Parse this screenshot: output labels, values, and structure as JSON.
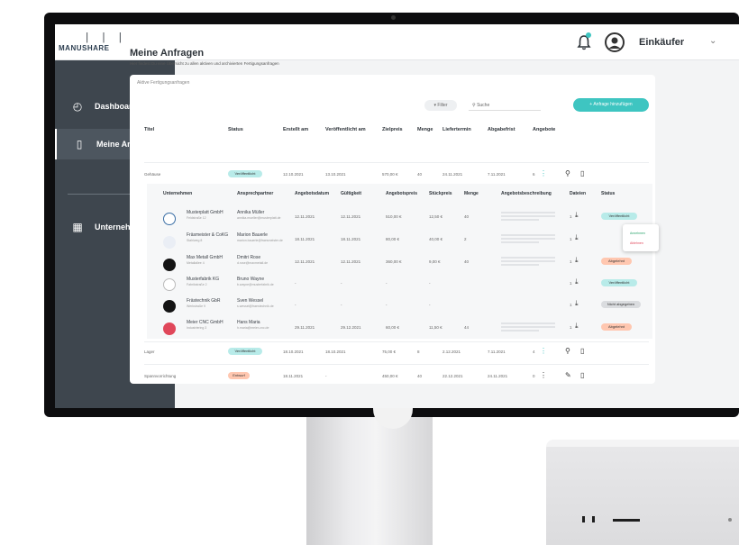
{
  "app": {
    "logo_text": "MANUSHARE",
    "logo_bars": "| | |",
    "user": "Einkäufer"
  },
  "sidebar": {
    "items": [
      {
        "label": "Dashboard"
      },
      {
        "label": "Meine Anfragen"
      },
      {
        "label": "Unternehmen"
      }
    ]
  },
  "main": {
    "title": "Meine Anfragen",
    "subtitle": "Hier findest Du eine Übersicht zu allen aktiven und archivierten Fertigungsanfragen",
    "card_title": "Aktive Fertigungsanfragen",
    "filter_label": "Filter",
    "search_placeholder": "Suche",
    "add_label": "+ Anfrage hinzufügen"
  },
  "table": {
    "headers": [
      "Titel",
      "Status",
      "Erstellt am",
      "Veröffentlicht am",
      "Zielpreis",
      "Menge",
      "Liefertermin",
      "Abgabefrist",
      "Angebote"
    ],
    "rows": [
      {
        "title": "Gehäuse",
        "status": "Veröffentlicht",
        "created": "12.10.2021",
        "published": "13.10.2021",
        "price": "570,00 €",
        "qty": "40",
        "delivery": "24.11.2021",
        "deadline": "7.11.2021",
        "offers": "6"
      },
      {
        "title": "Lager",
        "status": "Veröffentlicht",
        "created": "18.10.2021",
        "published": "18.10.2021",
        "price": "75,00 €",
        "qty": "8",
        "delivery": "2.12.2021",
        "deadline": "7.11.2021",
        "offers": "4"
      },
      {
        "title": "Spannvorrichtung",
        "status": "Entwurf",
        "created": "18.11.2021",
        "published": "-",
        "price": "450,00 €",
        "qty": "40",
        "delivery": "22.12.2021",
        "deadline": "24.11.2021",
        "offers": "0"
      }
    ]
  },
  "offers": {
    "headers": [
      "Unternehmen",
      "Ansprechpartner",
      "Angebotsdatum",
      "Gültigkeit",
      "Angebotspreis",
      "Stückpreis",
      "Menge",
      "Angebotsbeschreibung",
      "Dateien",
      "Status"
    ],
    "rows": [
      {
        "company": "Musterplatt GmbH",
        "company_sub": "Feldstraße 12",
        "contact": "Annika Müller",
        "contact_sub": "annika.mueller@musterplatt.de",
        "date": "12.11.2021",
        "valid": "12.11.2021",
        "price": "510,00 €",
        "unit": "12,50 €",
        "qty": "40",
        "files": "1",
        "status": "Veröffentlicht",
        "status_kind": "teal"
      },
      {
        "company": "Fräsmeister & CoKG",
        "company_sub": "Stahlweg 8",
        "contact": "Marion Bauerle",
        "contact_sub": "marion.bauerle@fraesmeister.de",
        "date": "18.11.2021",
        "valid": "18.11.2021",
        "price": "80,00 €",
        "unit": "40,00 €",
        "qty": "2",
        "files": "1",
        "status": "",
        "status_kind": ""
      },
      {
        "company": "Max Metall GmbH",
        "company_sub": "Metallallee 4",
        "contact": "Dmitri Rose",
        "contact_sub": "d.rose@maxmetall.de",
        "date": "12.11.2021",
        "valid": "12.11.2021",
        "price": "360,00 €",
        "unit": "9,00 €",
        "qty": "40",
        "files": "1",
        "status": "Abgelehnt",
        "status_kind": "orange"
      },
      {
        "company": "Musterfabrik KG",
        "company_sub": "Fabrikstraße 2",
        "contact": "Bruno Wayne",
        "contact_sub": "b.wayne@musterfabrik.de",
        "date": "-",
        "valid": "-",
        "price": "-",
        "unit": "-",
        "qty": "",
        "files": "1",
        "status": "Veröffentlicht",
        "status_kind": "teal"
      },
      {
        "company": "Frästechnik GbR",
        "company_sub": "Werkstraße 9",
        "contact": "Sven Wessel",
        "contact_sub": "s.wessel@fraestechnik.de",
        "date": "-",
        "valid": "-",
        "price": "-",
        "unit": "-",
        "qty": "",
        "files": "1",
        "status": "Nicht abgegeben",
        "status_kind": "grey"
      },
      {
        "company": "Meier CNC GmbH",
        "company_sub": "Industriering 3",
        "contact": "Hans Maria",
        "contact_sub": "h.maria@meier-cnc.de",
        "date": "29.11.2021",
        "valid": "29.12.2021",
        "price": "60,00 €",
        "unit": "11,50 €",
        "qty": "44",
        "files": "1",
        "status": "Abgelehnt",
        "status_kind": "orange"
      }
    ],
    "dropdown": [
      "Annehmen",
      "Ablehnen"
    ]
  },
  "colors": {
    "accent": "#3ec5c1",
    "sidebar": "#3e464e",
    "declined": "#ffc7b0"
  }
}
